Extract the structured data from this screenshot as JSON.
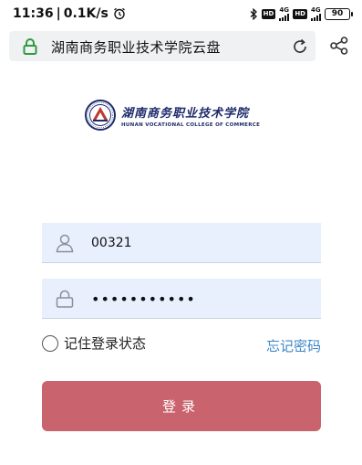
{
  "status_bar": {
    "time": "11:36",
    "speed": "0.1K/s",
    "hd_label": "HD",
    "network_label": "4G",
    "battery": "90"
  },
  "address_bar": {
    "url_text": "湖南商务职业技术学院云盘"
  },
  "logo": {
    "name_cn": "湖南商务职业技术学院",
    "name_en": "HUNAN VOCATIONAL COLLEGE OF COMMERCE"
  },
  "login_form": {
    "username_value": "00321",
    "password_value": "•••••••••••",
    "remember_label": "记住登录状态",
    "remember_checked": false,
    "forgot_label": "忘记密码",
    "submit_label": "登录"
  },
  "colors": {
    "field_bg": "#e8f0fe",
    "button_bg": "#c9636d",
    "link": "#3a86c8",
    "lock_green": "#2e9b3f",
    "logo_navy": "#1d2b6b"
  },
  "icons": {
    "alarm": "alarm-clock-icon",
    "bluetooth": "bluetooth-icon",
    "lock": "lock-icon",
    "reload": "reload-icon",
    "share": "share-icon",
    "user": "user-icon",
    "password": "padlock-icon"
  }
}
